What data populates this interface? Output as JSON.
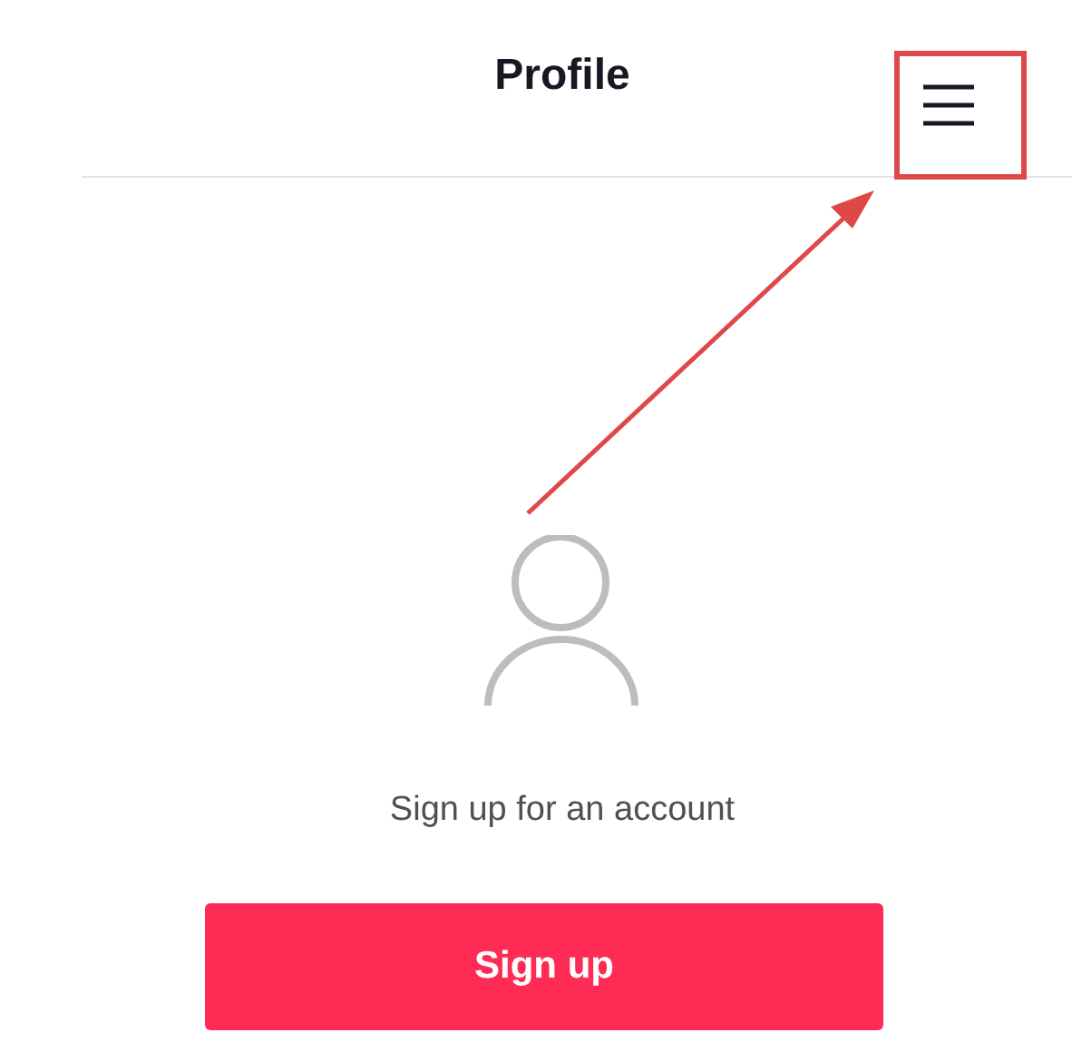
{
  "header": {
    "title": "Profile"
  },
  "prompt": "Sign up for an account",
  "signup_button": {
    "label": "Sign up"
  }
}
